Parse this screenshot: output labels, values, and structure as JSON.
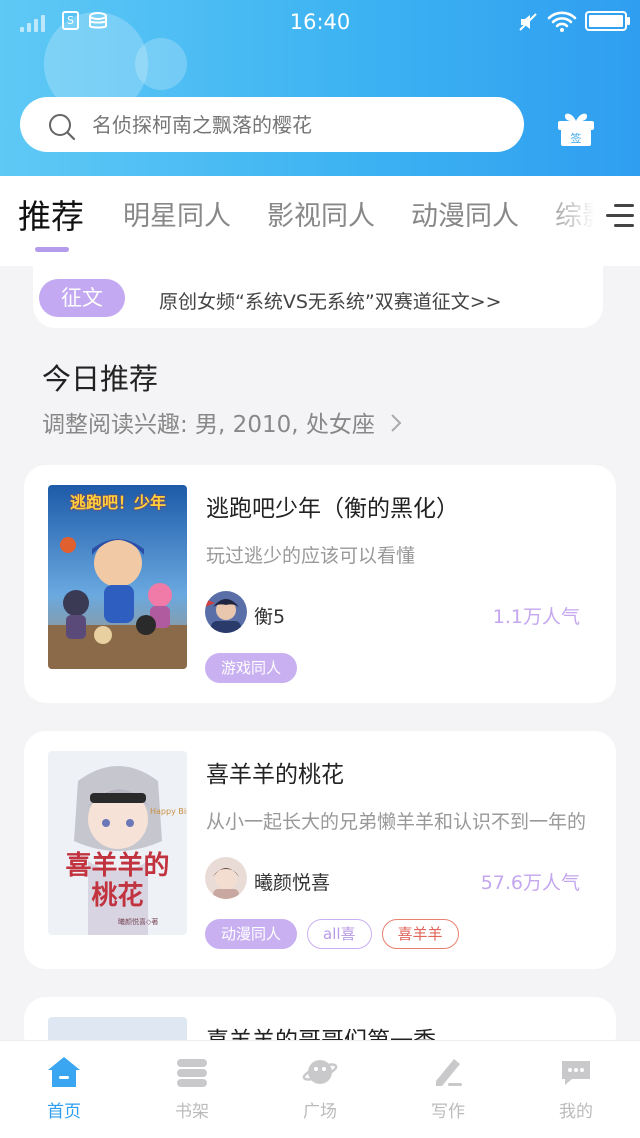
{
  "status_bar": {
    "time": "16:40"
  },
  "search": {
    "placeholder": "名侦探柯南之飘落的樱花"
  },
  "gift": {
    "label": "签"
  },
  "tabs": [
    "推荐",
    "明星同人",
    "影视同人",
    "动漫同人",
    "综影"
  ],
  "notice": {
    "tag": "征文",
    "text": "原创女频“系统VS无系统”双赛道征文>>"
  },
  "section": {
    "title": "今日推荐",
    "subtitle": "调整阅读兴趣: 男, 2010, 处女座"
  },
  "books": [
    {
      "title": "逃跑吧少年（衡的黑化）",
      "desc": "玩过逃少的应该可以看懂",
      "author": "衡5",
      "popularity": "1.1万人气",
      "tags": [
        "游戏同人"
      ],
      "cover_text": "逃跑吧！少年"
    },
    {
      "title": "喜羊羊的桃花",
      "desc": "从小一起长大的兄弟懒羊羊和认识不到一年的",
      "author": "曦颜悦喜",
      "popularity": "57.6万人气",
      "tags": [
        "动漫同人",
        "all喜",
        "喜羊羊"
      ],
      "cover_text": "喜羊羊的桃花",
      "cover_small": "曦颜悦喜◇著",
      "cover_script": "Happy Bir"
    },
    {
      "title": "喜羊羊的哥哥们第一季"
    }
  ],
  "bottom_nav": [
    "首页",
    "书架",
    "广场",
    "写作",
    "我的"
  ],
  "colors": {
    "header": "#3db3f2",
    "accent": "#c3a9f2",
    "nav_active": "#2d9ef0"
  }
}
